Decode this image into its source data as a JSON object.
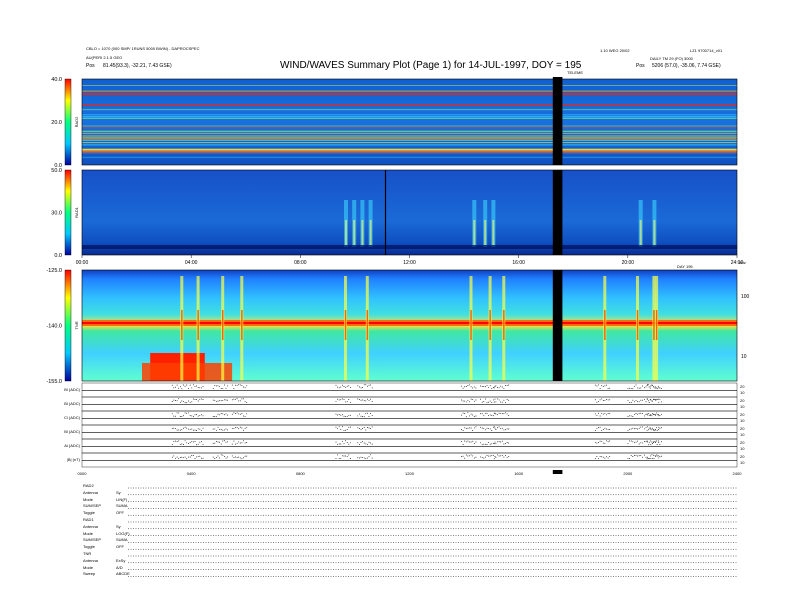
{
  "chart_data": [
    {
      "type": "heatmap",
      "title": "WIND/WAVES Summary Plot (Page 1) for 14-JUL-1997, DOY = 195",
      "panels": [
        {
          "name": "RAD2",
          "ylim": [
            0,
            40
          ],
          "yticks": [
            "40.0",
            "20.0",
            "0.0"
          ]
        },
        {
          "name": "RAD1",
          "ylim": [
            0,
            50
          ],
          "yticks": [
            "50.0",
            "30.0",
            "0.0"
          ]
        },
        {
          "name": "TNR",
          "ylim": [
            -155,
            -125
          ],
          "yticks": [
            "-125.0",
            "-140.0",
            "-155.0"
          ],
          "right_ticks": [
            "100",
            "10"
          ],
          "right_label": "kHz"
        }
      ],
      "xticks_top": [
        "00:00",
        "04:00",
        "08:00",
        "12:00",
        "16:00",
        "20:00",
        "24:00"
      ],
      "xticks_bottom": [
        "0000",
        "0400",
        "0800",
        "1200",
        "1600",
        "2000",
        "2400"
      ],
      "x_label_right": "DAY 195",
      "data_gap": {
        "start": "17:15",
        "end": "17:35"
      }
    },
    {
      "type": "line",
      "series": [
        {
          "name": "Bl (ADC)",
          "right_ticks": [
            "20",
            "10"
          ]
        },
        {
          "name": "Bl (ADC)",
          "right_ticks": [
            "20",
            "10"
          ]
        },
        {
          "name": "Cl (ADC)",
          "right_ticks": [
            "20",
            "10"
          ]
        },
        {
          "name": "Bl (ADC)",
          "right_ticks": [
            "20",
            "10"
          ]
        },
        {
          "name": "Al (ADC)",
          "right_ticks": [
            "20",
            "10"
          ]
        },
        {
          "name": "|B| (nT)",
          "right_ticks": [
            "20",
            "10"
          ]
        }
      ],
      "bursts_hours": [
        3.6,
        4.2,
        5.1,
        5.8,
        9.6,
        10.4,
        14.2,
        14.9,
        15.4,
        19.1,
        20.3,
        20.9,
        21.0
      ]
    }
  ],
  "header": {
    "left_line1": "CBLO = 1070 (000 SMP/ 1RUNS 5000 BWIN) - DAPROCSPEC",
    "left_line2": "AU(PERI 2.1.5 GEO",
    "left_pos_label": "Pos",
    "left_pos_value": "81.45(93.3), -32.21, 7.43 GSE)",
    "right_line1": "LZ1 9700714_v01",
    "right_line2": "DAILY TM 29 (FO) 3000",
    "right_pos_label": "Pos",
    "right_pos_value": "5206 (57.0), -35.06, 7.74 GSE)",
    "center_right": "1.10 WEG 20/02",
    "timeline": "TELEME"
  },
  "settings": [
    {
      "label": "RAD2",
      "value": ""
    },
    {
      "label": "Antenna",
      "value": "Sy"
    },
    {
      "label": "Mode",
      "value": "LIN(F)"
    },
    {
      "label": "SUM/SEP",
      "value": "SUMA"
    },
    {
      "label": "Toggle",
      "value": "OFF"
    },
    {
      "label": "RAD1",
      "value": ""
    },
    {
      "label": "Antenna",
      "value": "Sy"
    },
    {
      "label": "Mode",
      "value": "LOG(F)"
    },
    {
      "label": "SUM/SEP",
      "value": "SUMA"
    },
    {
      "label": "Toggle",
      "value": "OFF"
    },
    {
      "label": "TNR",
      "value": ""
    },
    {
      "label": "Antenna",
      "value": "ExSy"
    },
    {
      "label": "Mode",
      "value": "A/D"
    },
    {
      "label": "Sweep",
      "value": "ABCDE"
    }
  ],
  "colors": {
    "low": "#000080",
    "mid": "#00c8ff",
    "high": "#ffff00",
    "max": "#ff0000",
    "gap": "#000000"
  }
}
